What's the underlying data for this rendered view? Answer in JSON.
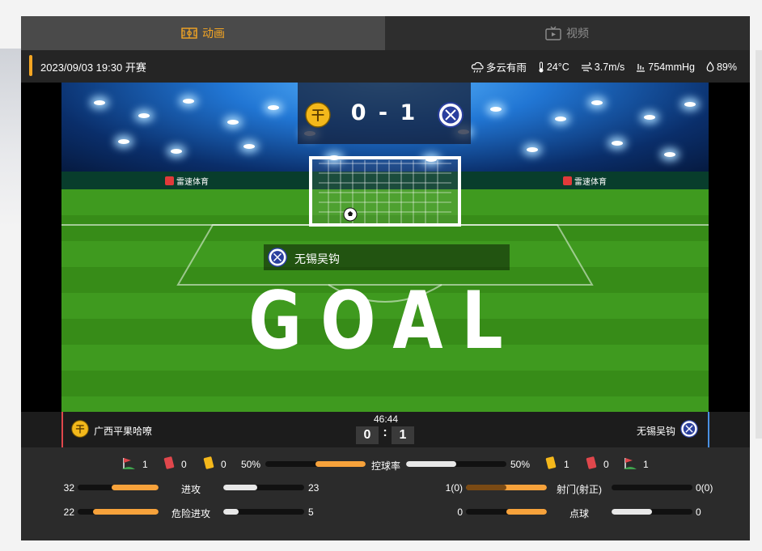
{
  "tabs": {
    "animation": "动画",
    "video": "视频"
  },
  "info": {
    "kickoff": "2023/09/03 19:30 开赛",
    "weather": "多云有雨",
    "temperature": "24°C",
    "wind": "3.7m/s",
    "pressure": "754mmHg",
    "humidity": "89%"
  },
  "scoreboard": {
    "score": "0 - 1"
  },
  "ads": {
    "left": "雷速体育",
    "right": "雷速体育"
  },
  "goal_banner": {
    "team": "无锡吴钩",
    "text": "GOAL"
  },
  "match": {
    "home_team": "广西平果哈嘹",
    "away_team": "无锡吴钩",
    "minute": "46:44",
    "home_score": "0",
    "away_score": "1",
    "home_color": "#e0474c",
    "away_color": "#4a90e2"
  },
  "events": {
    "home": {
      "corners": "1",
      "red_cards": "0",
      "yellow_cards": "0"
    },
    "away": {
      "yellow_cards": "1",
      "red_cards": "0",
      "corners": "1"
    }
  },
  "possession": {
    "label": "控球率",
    "home": "50%",
    "away": "50%",
    "home_value": 50,
    "away_value": 50
  },
  "stats_left": [
    {
      "label": "进攻",
      "home": "32",
      "away": "23",
      "home_value": 32,
      "away_value": 23
    },
    {
      "label": "危险进攻",
      "home": "22",
      "away": "5",
      "home_value": 22,
      "away_value": 5
    }
  ],
  "stats_right": [
    {
      "label": "射门(射正)",
      "home": "1(0)",
      "away": "0(0)",
      "home_value": 1,
      "away_value": 0
    },
    {
      "label": "点球",
      "home": "0",
      "away": "0",
      "home_value": 0,
      "away_value": 0
    }
  ],
  "colors": {
    "accent": "#f5a623",
    "bar_home": "#f7a23b",
    "bar_away": "#e8e8e8",
    "pitch": "#3f9a1f"
  }
}
